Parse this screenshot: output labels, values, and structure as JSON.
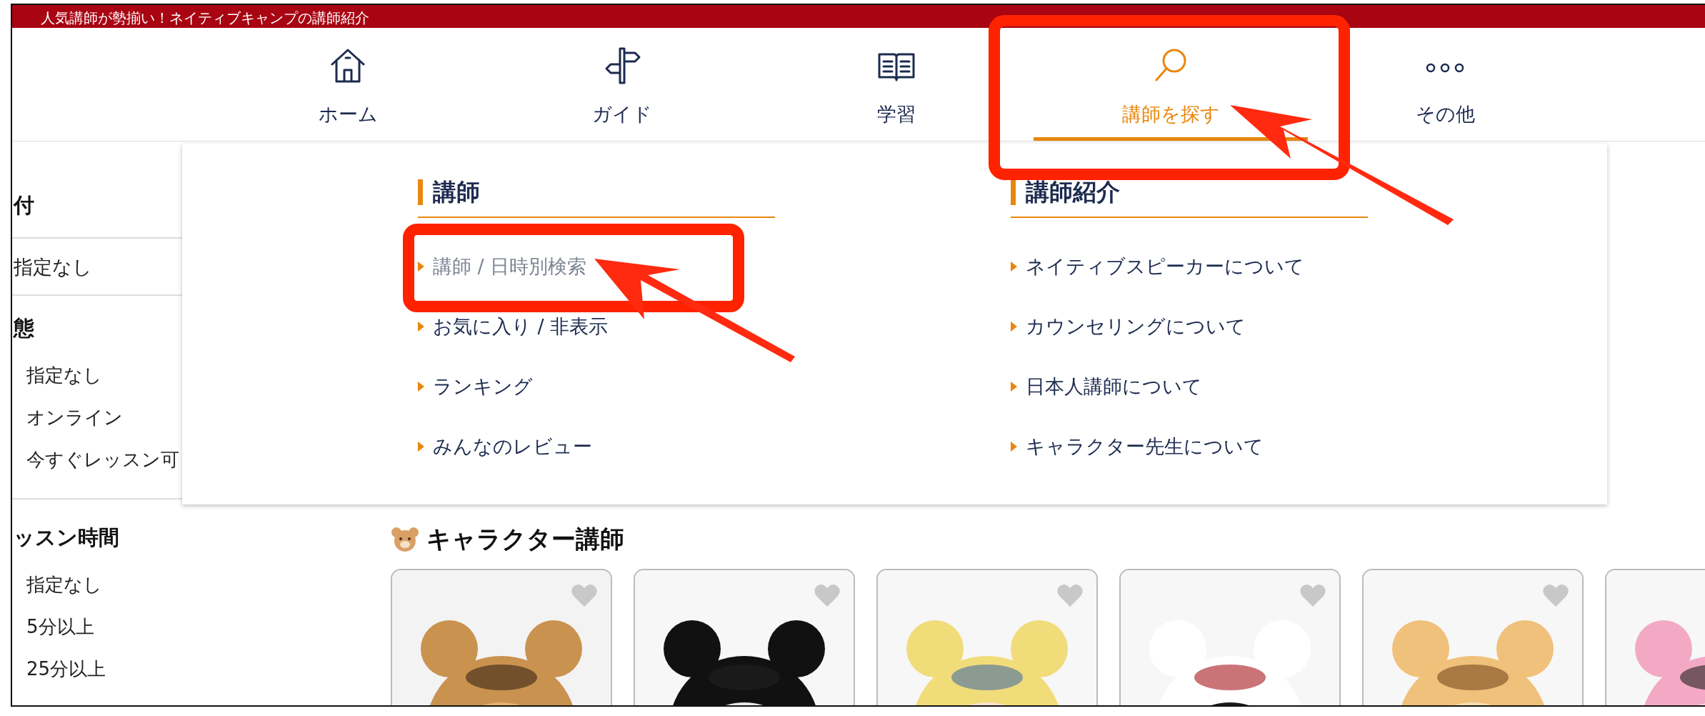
{
  "top_banner": {
    "text": "人気講師が勢揃い！ネイティブキャンプの講師紹介"
  },
  "nav": [
    {
      "label": "ホーム",
      "selected": false
    },
    {
      "label": "ガイド",
      "selected": false
    },
    {
      "label": "学習",
      "selected": false
    },
    {
      "label": "講師を探す",
      "selected": true
    },
    {
      "label": "その他",
      "selected": false
    }
  ],
  "sidebar": [
    {
      "kind": "single",
      "heading": "付",
      "items": [
        "指定なし"
      ]
    },
    {
      "kind": "list",
      "heading": "態",
      "items": [
        "指定なし",
        "オンライン",
        "今すぐレッスン可"
      ]
    },
    {
      "kind": "list",
      "heading": "ッスン時間",
      "items": [
        "指定なし",
        "5分以上",
        "25分以上"
      ]
    }
  ],
  "dropdown": {
    "columns": [
      {
        "heading": "講師",
        "items": [
          {
            "label": "講師 / 日時別検索",
            "highlighted": true
          },
          {
            "label": "お気に入り / 非表示",
            "highlighted": false
          },
          {
            "label": "ランキング",
            "highlighted": false
          },
          {
            "label": "みんなのレビュー",
            "highlighted": false
          }
        ]
      },
      {
        "heading": "講師紹介",
        "items": [
          {
            "label": "ネイティブスピーカーについて",
            "highlighted": false
          },
          {
            "label": "カウンセリングについて",
            "highlighted": false
          },
          {
            "label": "日本人講師について",
            "highlighted": false
          },
          {
            "label": "キャラクター先生について",
            "highlighted": false
          }
        ]
      }
    ]
  },
  "character_section": {
    "title": "キャラクター講師"
  }
}
